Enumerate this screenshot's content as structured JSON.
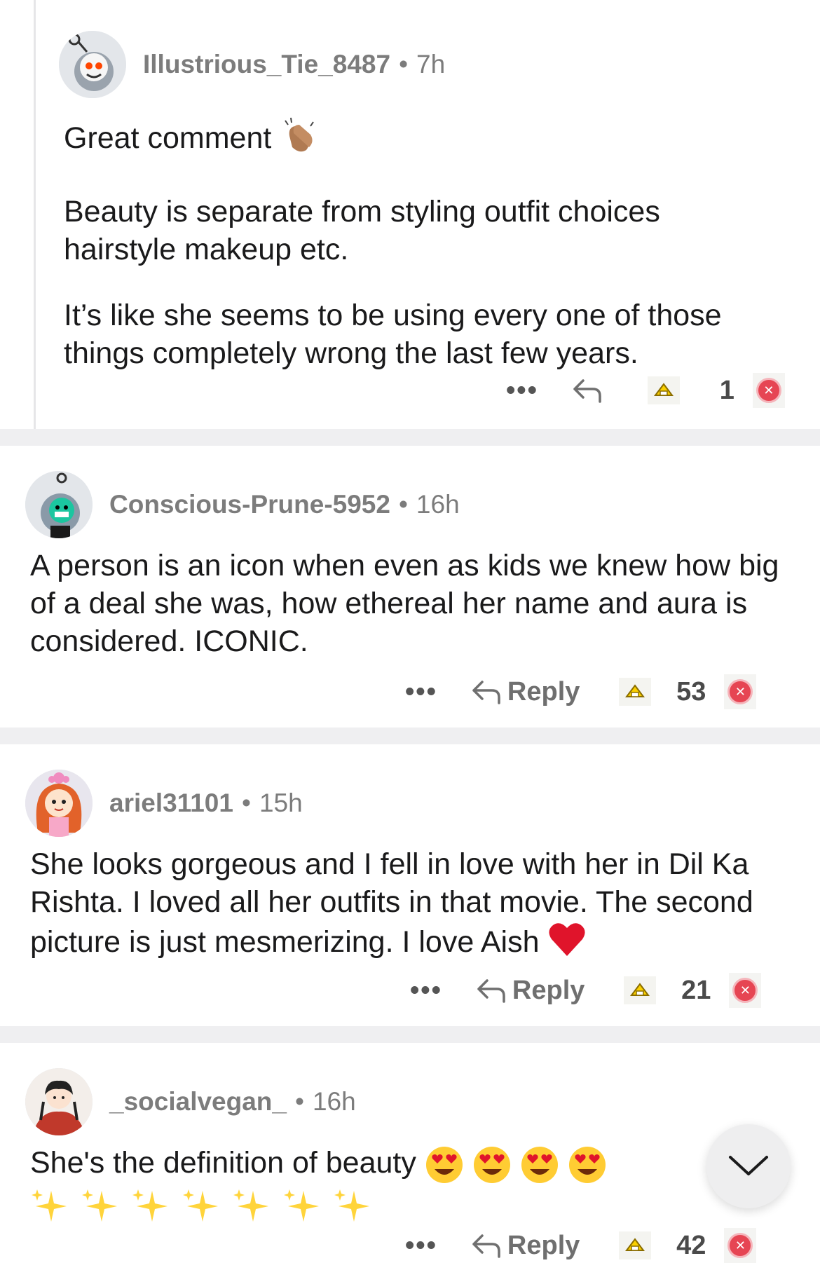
{
  "comments": [
    {
      "username": "Illustrious_Tie_8487",
      "time": "7h",
      "paragraphs": [
        "Great comment",
        "Beauty is separate from styling outfit choices hairstyle makeup etc.",
        "It’s like she seems to be using every one of those things completely wrong the last few years."
      ],
      "reply_label": "",
      "votes": "1"
    },
    {
      "username": "Conscious-Prune-5952",
      "time": "16h",
      "paragraphs": [
        "A person is an icon when even as kids we knew how big of a deal she was, how ethereal her name and aura is considered. ICONIC."
      ],
      "reply_label": "Reply",
      "votes": "53"
    },
    {
      "username": "ariel31101",
      "time": "15h",
      "paragraphs": [
        "She looks gorgeous and I fell in love with her in Dil Ka Rishta. I loved all her outfits in that movie. The second picture is just mesmerizing. I love Aish"
      ],
      "reply_label": "Reply",
      "votes": "21"
    },
    {
      "username": "_socialvegan_",
      "time": "16h",
      "paragraphs": [
        "She's the definition of beauty"
      ],
      "reply_label": "Reply",
      "votes": "42"
    }
  ],
  "separator": "•",
  "more_label": "•••",
  "colors": {
    "downvote": "#e64553",
    "separator_bg": "#efeff1",
    "meta_text": "#7c7c7c"
  }
}
